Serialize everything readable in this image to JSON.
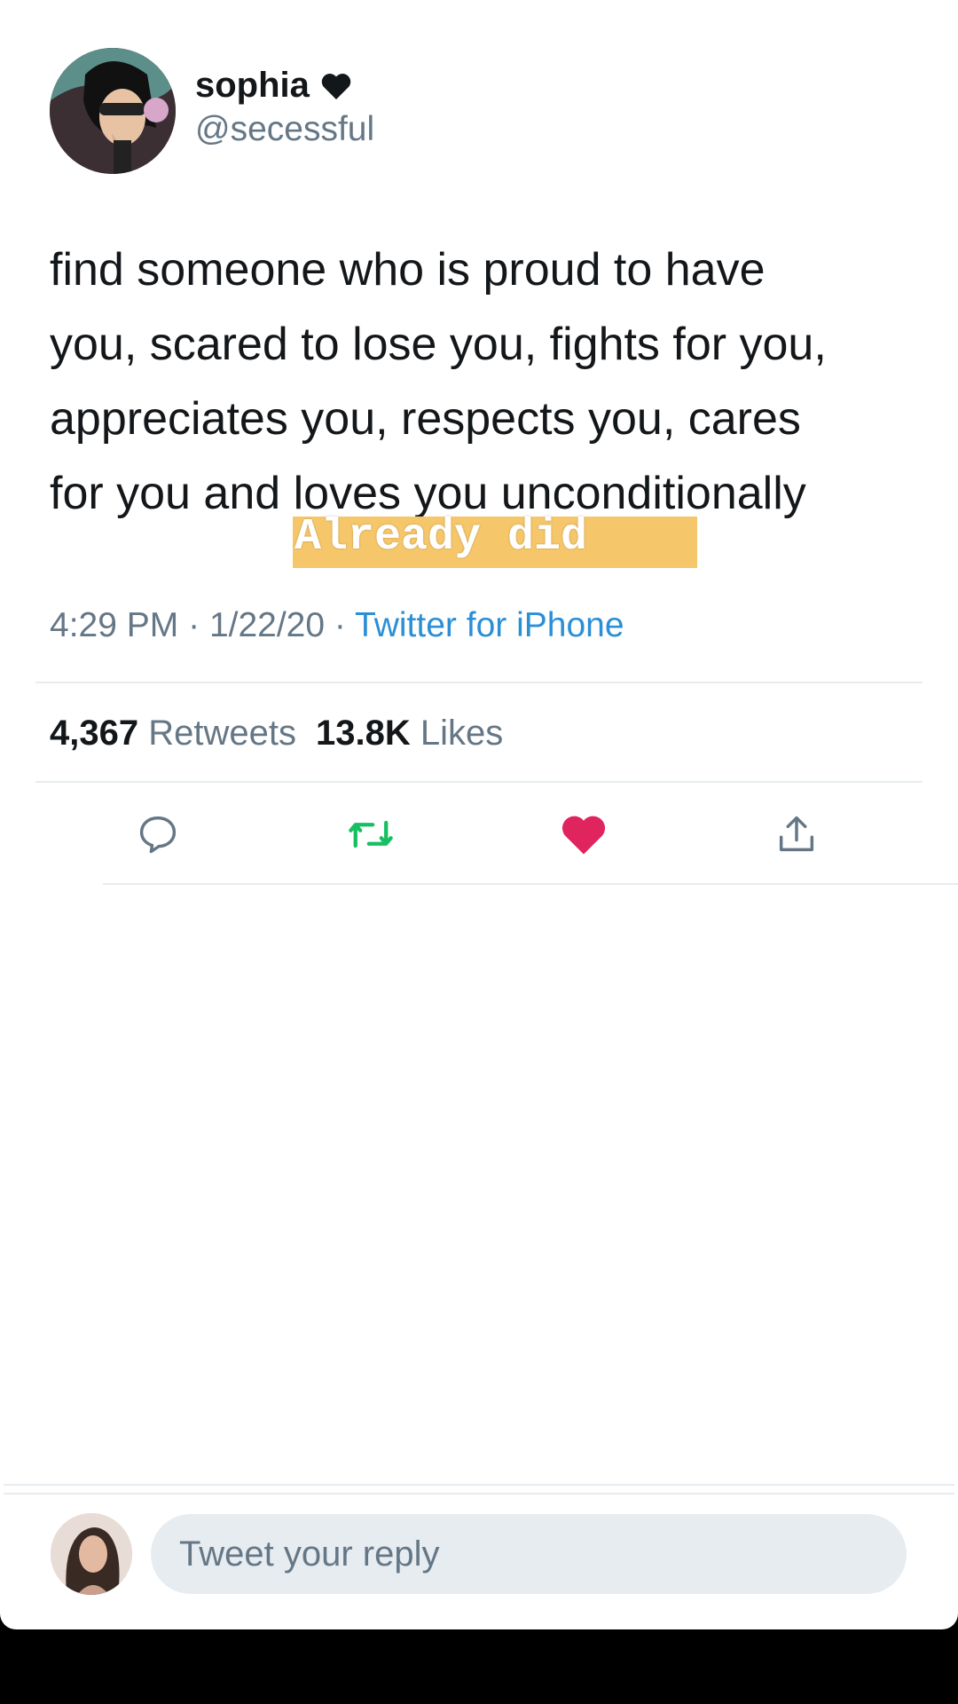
{
  "user": {
    "display_name": "sophia",
    "handle": "@secessful",
    "badge_icon": "black-heart-icon"
  },
  "tweet": {
    "text": "find someone who is proud to have\nyou, scared to lose you, fights for you,\nappreciates you, respects you, cares\nfor you and loves you unconditionally",
    "overlay_caption": "Already did",
    "time": "4:29 PM",
    "date": "1/22/20",
    "source": "Twitter for iPhone",
    "separator": "·"
  },
  "stats": {
    "retweets_count": "4,367",
    "retweets_label": "Retweets",
    "likes_count": "13.8K",
    "likes_label": "Likes"
  },
  "actions": [
    {
      "name": "reply",
      "icon": "comment-icon"
    },
    {
      "name": "retweet",
      "icon": "retweet-icon",
      "color": "#17bf63"
    },
    {
      "name": "like",
      "icon": "heart-icon",
      "color": "#e0245e",
      "active": true
    },
    {
      "name": "share",
      "icon": "share-icon"
    }
  ],
  "reply": {
    "placeholder": "Tweet your reply"
  },
  "colors": {
    "accent": "#1da1f2",
    "sticker_bg": "#f6c66a",
    "like": "#e0245e",
    "retweet": "#17bf63"
  }
}
